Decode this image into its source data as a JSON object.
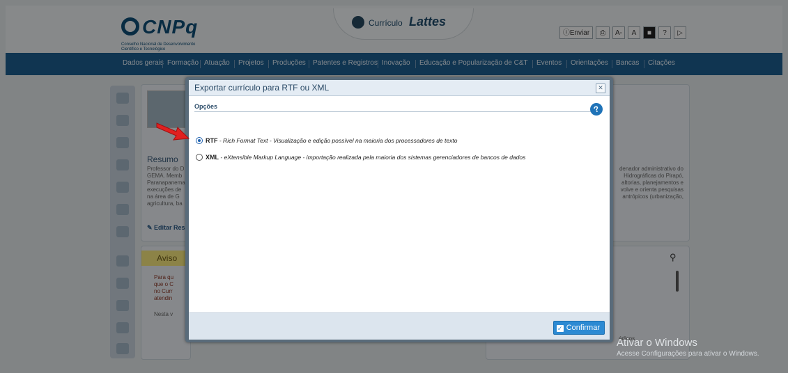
{
  "header": {
    "cnpq_logo": "CNPq",
    "cnpq_subtitle": "Conselho Nacional de Desenvolvimento Científico e Tecnológico",
    "lattes_prefix": "Currículo",
    "lattes_name": "Lattes",
    "tools": {
      "send_label": "Enviar",
      "font_dec": "A-",
      "font_inc": "A",
      "help": "?"
    }
  },
  "nav": {
    "items": [
      "Dados gerais",
      "Formação",
      "Atuação",
      "Projetos",
      "Produções",
      "Patentes e Registros",
      "Inovação",
      "Educação e Popularização de C&T",
      "Eventos",
      "Orientações",
      "Bancas",
      "Citações"
    ]
  },
  "background": {
    "resumo_title": "Resumo",
    "resumo_left_lines": [
      "Professor do D",
      "GEMA. Memb",
      "Paranapanema",
      "execuções de",
      "na área de G",
      "agricultura, ba"
    ],
    "resumo_right_lines": [
      "denador administrativo do",
      "Hidrográficas do Pirapó,",
      "altorias, planejamentos e",
      "volve e orienta pesquisas",
      "antrópicos (urbanização,"
    ],
    "edit_label": "Editar Res",
    "aviso_title": "Aviso",
    "aviso_lines": [
      "Para qu",
      "que o C",
      "no Curr",
      "atendin"
    ],
    "nesta_label": "Nesta v",
    "partial_text": "édicos"
  },
  "dialog": {
    "title": "Exportar currículo para RTF ou XML",
    "close_icon_glyph": "✕",
    "section_label": "Opções",
    "options": [
      {
        "code": "RTF",
        "description": " - Rich Format Text - Visualização e edição possível na maioria dos processadores de texto",
        "selected": true
      },
      {
        "code": "XML",
        "description": " - eXtensible Markup Language - importação realizada pela maioria dos sistemas gerenciadores de bancos de dados",
        "selected": false
      }
    ],
    "confirm_label": "Confirmar"
  },
  "watermark": {
    "line1": "Ativar o Windows",
    "line2": "Acesse Configurações para ativar o Windows."
  },
  "colors": {
    "nav_bar": "#1d5c8c",
    "accent": "#2c8ad3",
    "arrow": "#e02020"
  }
}
